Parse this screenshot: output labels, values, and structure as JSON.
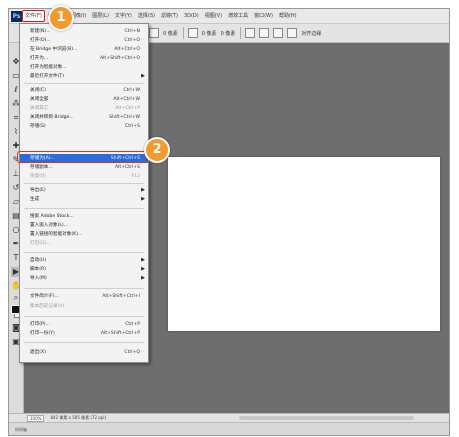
{
  "app": {
    "logo": "Ps",
    "menus": [
      "文件(F)",
      "编辑(E)",
      "图像(I)",
      "图层(L)",
      "文字(Y)",
      "选择(S)",
      "滤镜(T)",
      "3D(D)",
      "视图(V)",
      "增效工具",
      "窗口(W)",
      "帮助(H)"
    ]
  },
  "options_bar": {
    "feather": "0 像素",
    "width": "0 像素",
    "height": "0 像素",
    "align": "对齐边缘"
  },
  "file_menu": {
    "items": [
      {
        "label": "新建(N)...",
        "shortcut": "Ctrl+N"
      },
      {
        "label": "打开(O)...",
        "shortcut": "Ctrl+O"
      },
      {
        "label": "在 Bridge 中浏览(B)...",
        "shortcut": "Alt+Ctrl+O"
      },
      {
        "label": "打开为...",
        "shortcut": "Alt+Shift+Ctrl+O"
      },
      {
        "label": "打开为智能对象...",
        "shortcut": ""
      },
      {
        "label": "最近打开文件(T)",
        "shortcut": "",
        "submenu": true
      },
      {
        "label": "关闭(C)",
        "shortcut": "Ctrl+W"
      },
      {
        "label": "关闭全部",
        "shortcut": "Alt+Ctrl+W"
      },
      {
        "label": "关闭其它",
        "shortcut": "Alt+Ctrl+P",
        "disabled": true
      },
      {
        "label": "关闭并转到 Bridge...",
        "shortcut": "Shift+Ctrl+W"
      },
      {
        "label": "存储(S)",
        "shortcut": "Ctrl+S"
      },
      {
        "label": "存储为(A)...",
        "shortcut": "Shift+Ctrl+S",
        "highlighted": true
      },
      {
        "label": "存储副本...",
        "shortcut": "Alt+Ctrl+S"
      },
      {
        "label": "恢复(V)",
        "shortcut": "F12",
        "disabled": true
      },
      {
        "label": "导出(E)",
        "shortcut": "",
        "submenu": true
      },
      {
        "label": "生成",
        "shortcut": "",
        "submenu": true
      },
      {
        "label": "搜索 Adobe Stock...",
        "shortcut": ""
      },
      {
        "label": "置入嵌入对象(L)...",
        "shortcut": ""
      },
      {
        "label": "置入链接的智能对象(K)...",
        "shortcut": ""
      },
      {
        "label": "打包(G)...",
        "shortcut": "",
        "disabled": true
      },
      {
        "label": "自动(U)",
        "shortcut": "",
        "submenu": true
      },
      {
        "label": "脚本(R)",
        "shortcut": "",
        "submenu": true
      },
      {
        "label": "导入(M)",
        "shortcut": "",
        "submenu": true
      },
      {
        "label": "文件简介(F)...",
        "shortcut": "Alt+Shift+Ctrl+I"
      },
      {
        "label": "版本历史记录(V)",
        "shortcut": "",
        "disabled": true
      },
      {
        "label": "打印(P)...",
        "shortcut": "Ctrl+P"
      },
      {
        "label": "打印一份(Y)",
        "shortcut": "Alt+Shift+Ctrl+P"
      },
      {
        "label": "退出(X)",
        "shortcut": "Ctrl+Q"
      }
    ]
  },
  "callouts": [
    "1",
    "2"
  ],
  "status": {
    "zoom": "100%",
    "doc": "842 像素 x 595 像素 (72 ppi)"
  },
  "timeline": {
    "label": "时间轴"
  },
  "colors": {
    "highlight": "#2d6cd6",
    "callout": "#f29a2e",
    "ring": "#d9302a"
  }
}
